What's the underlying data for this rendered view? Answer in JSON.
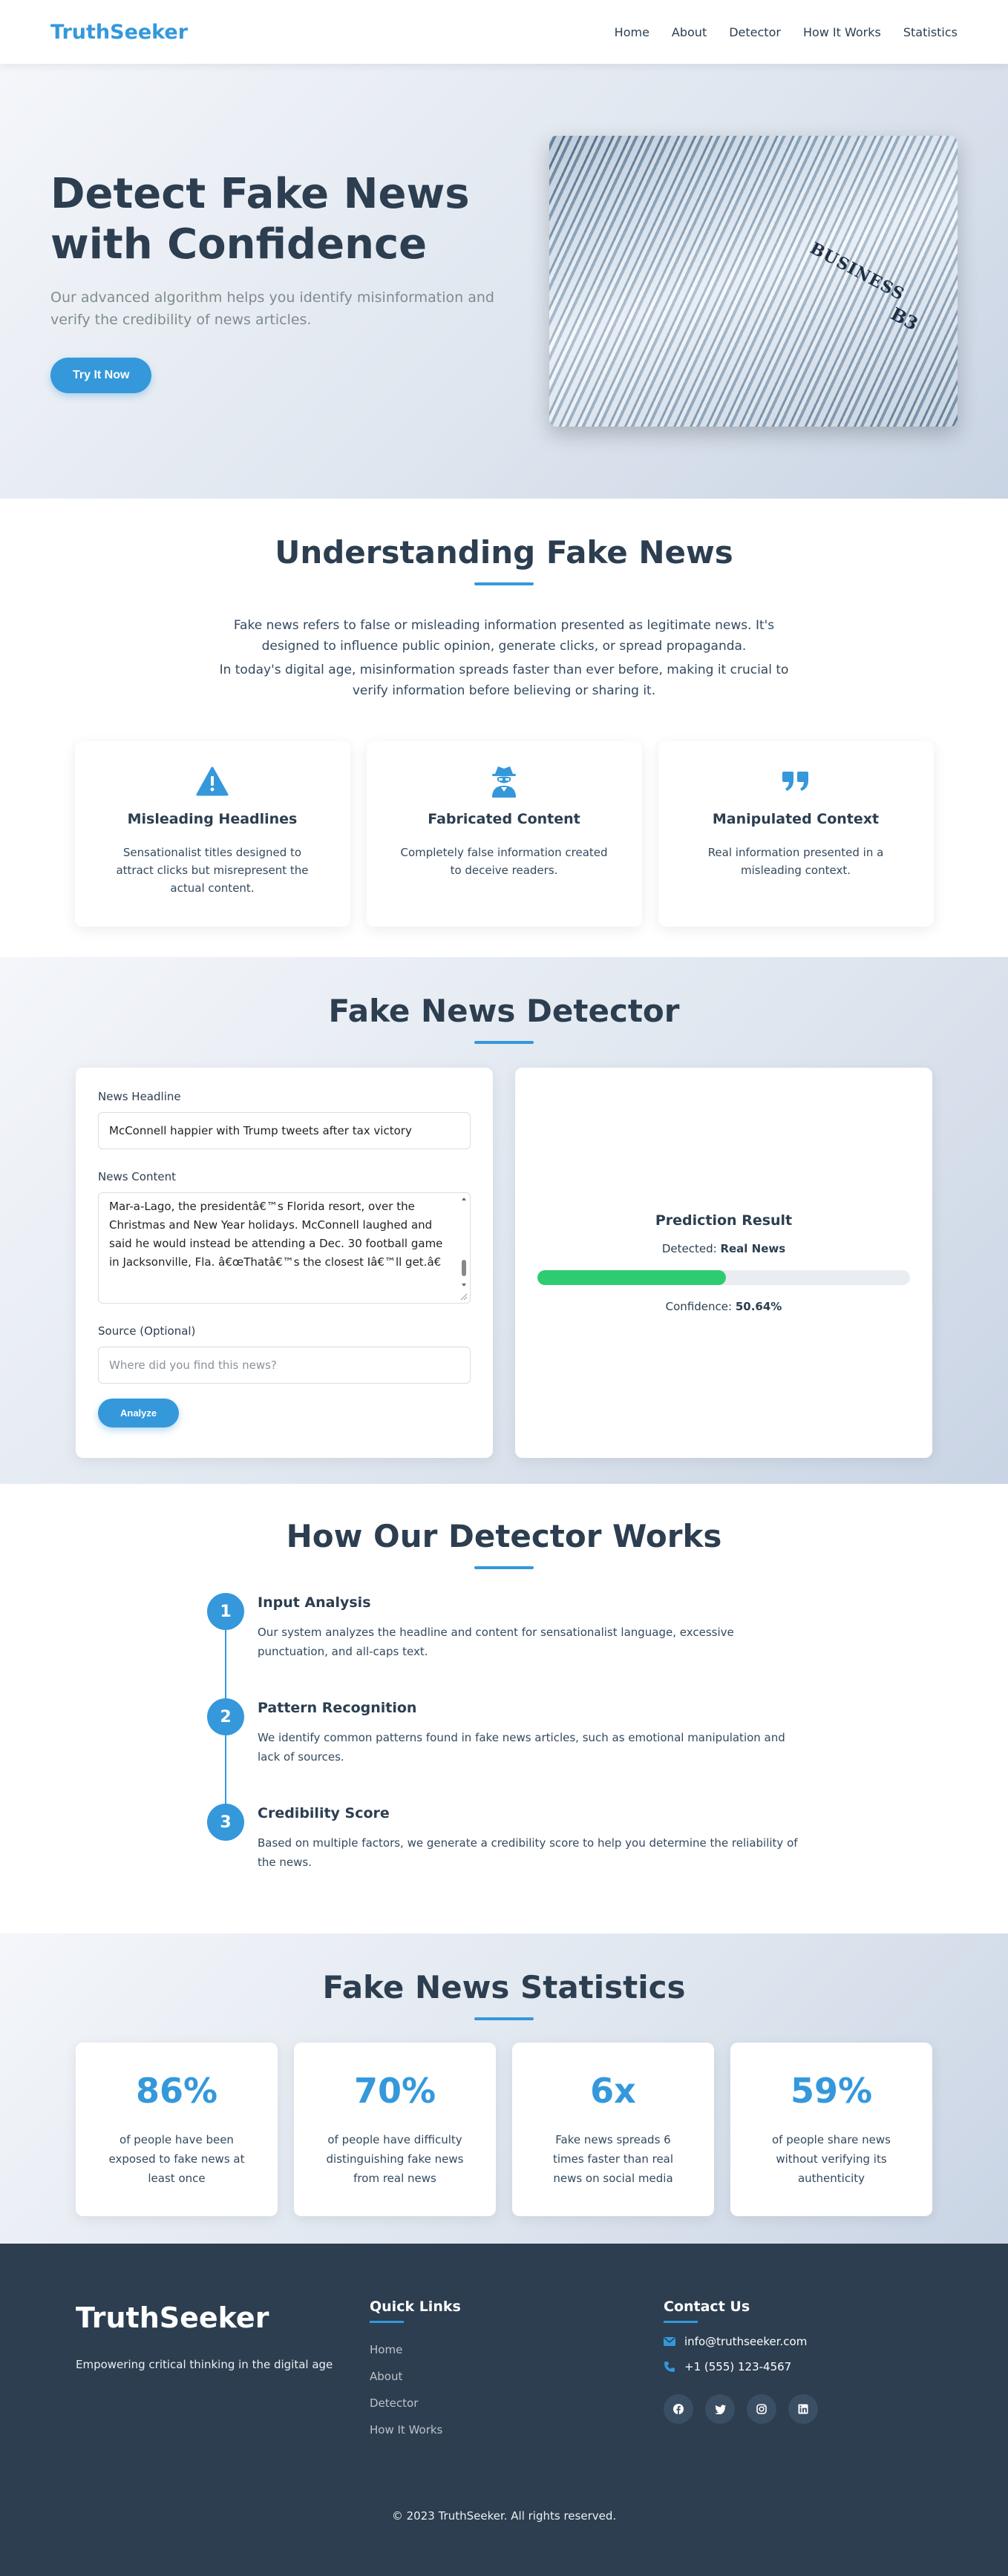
{
  "header": {
    "logo": "TruthSeeker",
    "nav": [
      "Home",
      "About",
      "Detector",
      "How It Works",
      "Statistics"
    ]
  },
  "hero": {
    "title": "Detect Fake News with Confidence",
    "subtitle": "Our advanced algorithm helps you identify misinformation and verify the credibility of news articles.",
    "cta": "Try It Now",
    "image_text": {
      "headline": "BUSINESS",
      "code": "B3"
    }
  },
  "understanding": {
    "title": "Understanding Fake News",
    "p1": "Fake news refers to false or misleading information presented as legitimate news. It's designed to influence public opinion, generate clicks, or spread propaganda.",
    "p2": "In today's digital age, misinformation spreads faster than ever before, making it crucial to verify information before believing or sharing it.",
    "cards": [
      {
        "icon": "warning-triangle-icon",
        "title": "Misleading Headlines",
        "text": "Sensationalist titles designed to attract clicks but misrepresent the actual content."
      },
      {
        "icon": "user-secret-icon",
        "title": "Fabricated Content",
        "text": "Completely false information created to deceive readers."
      },
      {
        "icon": "quote-icon",
        "title": "Manipulated Context",
        "text": "Real information presented in a misleading context."
      }
    ]
  },
  "detector": {
    "title": "Fake News Detector",
    "headline_label": "News Headline",
    "headline_value": "McConnell happier with Trump tweets after tax victory",
    "content_label": "News Content",
    "content_value": "Mar-a-Lago, the presidentâ€™s Florida resort, over the Christmas and New Year holidays. McConnell laughed and said he would instead be attending a Dec. 30 football game in Jacksonville, Fla. â€œThatâ€™s the closest Iâ€™ll get.â€",
    "source_label": "Source (Optional)",
    "source_placeholder": "Where did you find this news?",
    "analyze_label": "Analyze",
    "result": {
      "title": "Prediction Result",
      "detected_label": "Detected:",
      "detected_value": "Real News",
      "confidence_label": "Confidence:",
      "confidence_value": "50.64%",
      "confidence_fraction": 0.5064,
      "bar_color": "#2ecc71"
    }
  },
  "how": {
    "title": "How Our Detector Works",
    "steps": [
      {
        "num": "1",
        "title": "Input Analysis",
        "text": "Our system analyzes the headline and content for sensationalist language, excessive punctuation, and all-caps text."
      },
      {
        "num": "2",
        "title": "Pattern Recognition",
        "text": "We identify common patterns found in fake news articles, such as emotional manipulation and lack of sources."
      },
      {
        "num": "3",
        "title": "Credibility Score",
        "text": "Based on multiple factors, we generate a credibility score to help you determine the reliability of the news."
      }
    ]
  },
  "stats": {
    "title": "Fake News Statistics",
    "items": [
      {
        "value": "86%",
        "text": "of people have been exposed to fake news at least once"
      },
      {
        "value": "70%",
        "text": "of people have difficulty distinguishing fake news from real news"
      },
      {
        "value": "6x",
        "text": "Fake news spreads 6 times faster than real news on social media"
      },
      {
        "value": "59%",
        "text": "of people share news without verifying its authenticity"
      }
    ]
  },
  "footer": {
    "logo": "TruthSeeker",
    "tagline": "Empowering critical thinking in the digital age",
    "quick_links_title": "Quick Links",
    "links": [
      "Home",
      "About",
      "Detector",
      "How It Works"
    ],
    "contact_title": "Contact Us",
    "email": "info@truthseeker.com",
    "phone": "+1 (555) 123-4567",
    "socials": [
      "facebook-icon",
      "twitter-icon",
      "instagram-icon",
      "linkedin-icon"
    ],
    "copyright": "© 2023 TruthSeeker. All rights reserved."
  },
  "colors": {
    "accent": "#3498db",
    "dark": "#2c3e50",
    "success": "#2ecc71"
  }
}
